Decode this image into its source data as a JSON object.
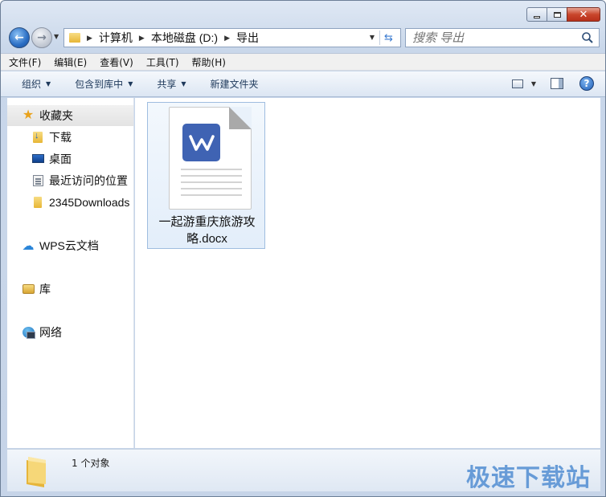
{
  "address": {
    "crumbs": [
      "计算机",
      "本地磁盘 (D:)",
      "导出"
    ]
  },
  "search": {
    "placeholder": "搜索 导出"
  },
  "menu": {
    "items": [
      "文件(F)",
      "编辑(E)",
      "查看(V)",
      "工具(T)",
      "帮助(H)"
    ]
  },
  "toolbar": {
    "organize": "组织",
    "include_in_library": "包含到库中",
    "share": "共享",
    "new_folder": "新建文件夹"
  },
  "nav": {
    "favorites": "收藏夹",
    "downloads": "下载",
    "desktop": "桌面",
    "recent_places": "最近访问的位置",
    "folder_2345": "2345Downloads",
    "wps_cloud": "WPS云文档",
    "libraries": "库",
    "network": "网络"
  },
  "files": [
    {
      "name_line1": "一起游重庆旅游攻",
      "name_line2": "略.docx",
      "icon": "wps-writer-doc-icon",
      "badge_letter": "W"
    }
  ],
  "status": {
    "count_text": "1 个对象"
  },
  "watermark": "极速下载站",
  "colors": {
    "wps_blue": "#3f63b3",
    "selection_border": "#9fbde0",
    "watermark_blue": "#5a93d4"
  }
}
